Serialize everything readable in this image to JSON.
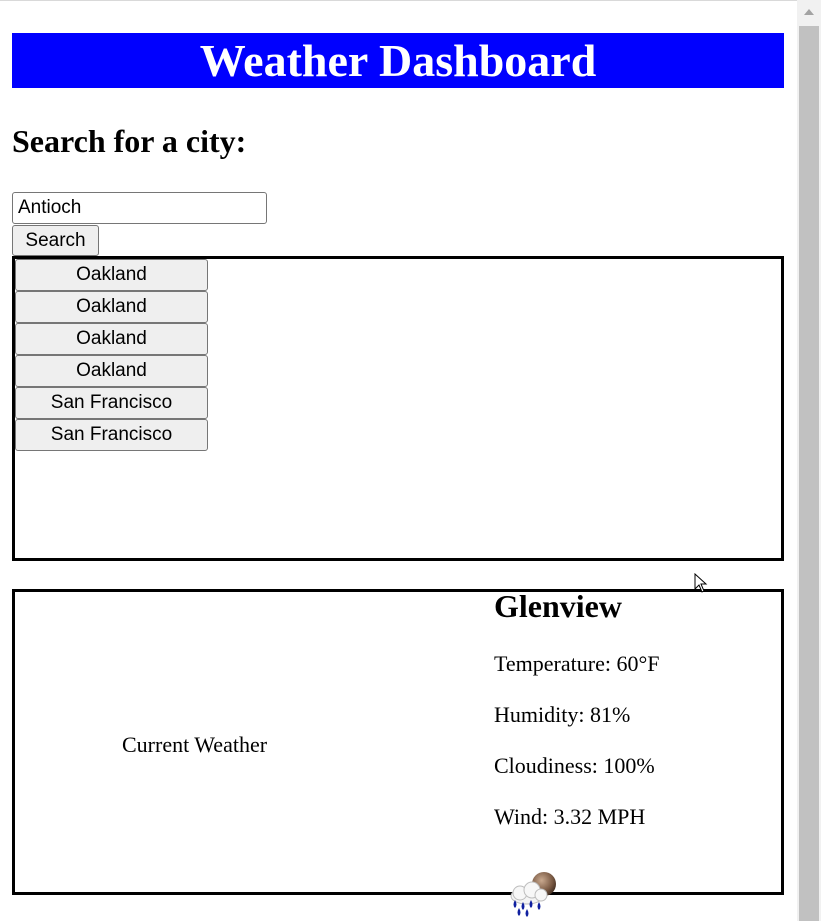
{
  "header": {
    "title": "Weather Dashboard"
  },
  "search": {
    "heading": "Search for a city:",
    "input_value": "Antioch",
    "button_label": "Search"
  },
  "history": {
    "items": [
      {
        "label": "Oakland"
      },
      {
        "label": "Oakland"
      },
      {
        "label": "Oakland"
      },
      {
        "label": "Oakland"
      },
      {
        "label": "San Francisco"
      },
      {
        "label": "San Francisco"
      }
    ]
  },
  "current": {
    "label": "Current Weather",
    "city": "Glenview",
    "temperature": "Temperature: 60°F",
    "humidity": "Humidity: 81%",
    "cloudiness": "Cloudiness: 100%",
    "wind": "Wind: 3.32 MPH",
    "icon": "rain-cloud-icon"
  },
  "colors": {
    "header_bg": "#0000ff",
    "header_text": "#ffffff"
  }
}
